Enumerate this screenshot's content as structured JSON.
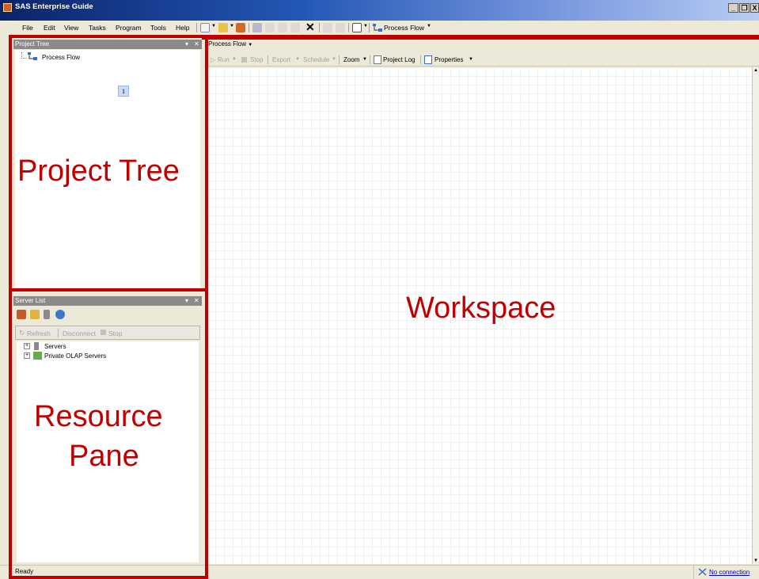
{
  "window": {
    "title": "SAS Enterprise Guide",
    "controls": [
      "_",
      "ħ",
      "X"
    ]
  },
  "menu": {
    "items": [
      "File",
      "Edit",
      "View",
      "Tasks",
      "Program",
      "Tools",
      "Help"
    ],
    "toolbar_process_flow": "Process Flow"
  },
  "project_tree": {
    "header": "Project Tree",
    "node_label": "Process Flow",
    "page_marker": "1",
    "overlay_label": "Project Tree"
  },
  "server_list": {
    "header": "Server List",
    "refresh": "Refresh",
    "disconnect": "Disconnect",
    "stop": "Stop",
    "items": [
      "Servers",
      "Private OLAP Servers"
    ],
    "overlay_label_line1": "Resource",
    "overlay_label_line2": "Pane"
  },
  "workspace": {
    "tab_label": "Process Flow",
    "toolbar": {
      "run": "Run",
      "stop": "Stop",
      "export": "Export",
      "schedule": "Schedule",
      "zoom": "Zoom",
      "project_log": "Project Log",
      "properties": "Properties"
    },
    "overlay_label": "Workspace"
  },
  "status": {
    "text": "Ready",
    "connection": "No connection"
  },
  "colors": {
    "annotation_red": "#c00000",
    "title_bar_start": "#0a246a",
    "link_blue": "#0000cc"
  }
}
